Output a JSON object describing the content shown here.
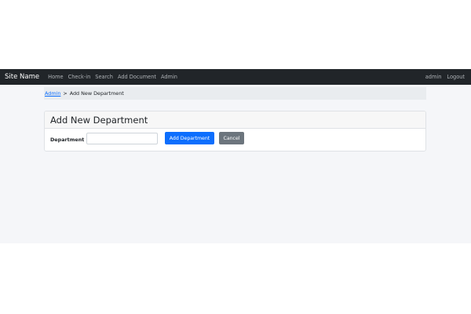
{
  "navbar": {
    "brand": "Site Name",
    "links": [
      "Home",
      "Check-in",
      "Search",
      "Add Document",
      "Admin"
    ],
    "right_links": [
      "admin",
      "Logout"
    ]
  },
  "breadcrumb": {
    "parent": "Admin",
    "separator": ">",
    "current": "Add New Department"
  },
  "card": {
    "title": "Add New Department",
    "field_label": "Department",
    "field_value": "",
    "field_placeholder": "",
    "submit_label": "Add Department",
    "cancel_label": "Cancel"
  },
  "colors": {
    "navbar_bg": "#212529",
    "primary": "#0d6efd",
    "secondary": "#6c757d",
    "page_bg": "#f5f6f9"
  }
}
